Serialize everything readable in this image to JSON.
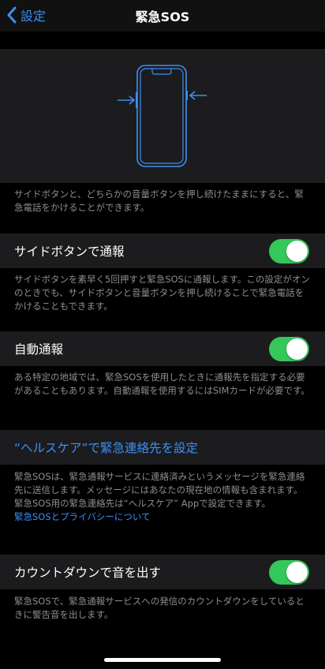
{
  "nav": {
    "back_label": "設定",
    "title": "緊急SOS"
  },
  "hero_description": "サイドボタンと、どちらかの音量ボタンを押し続けたままにすると、緊急電話をかけることができます。",
  "side_button_call": {
    "label": "サイドボタンで通報",
    "enabled": true,
    "description": "サイドボタンを素早く5回押すと緊急SOSに通報します。この設定がオンのときでも、サイドボタンと音量ボタンを押し続けることで緊急電話をかけることもできます。"
  },
  "auto_call": {
    "label": "自動通報",
    "enabled": true,
    "description": "ある特定の地域では、緊急SOSを使用したときに通報先を指定する必要があることもあります。自動通報を使用するにはSIMカードが必要です。"
  },
  "health_link": {
    "label": "“ヘルスケア”で緊急連絡先を設定",
    "description": "緊急SOSは、緊急通報サービスに連絡済みというメッセージを緊急連絡先に送信します。メッセージにはあなたの現在地の情報も含まれます。緊急SOS用の緊急連絡先は“ヘルスケア” Appで設定できます。",
    "privacy_link": "緊急SOSとプライバシーについて"
  },
  "countdown_sound": {
    "label": "カウントダウンで音を出す",
    "enabled": true,
    "description": "緊急SOSで、緊急通報サービスへの発信のカウントダウンをしているときに警告音を出します。"
  },
  "colors": {
    "accent": "#3d8ff5",
    "toggle_on": "#34c759",
    "cell": "#1c1c1e",
    "footnote": "#8e8e93"
  }
}
